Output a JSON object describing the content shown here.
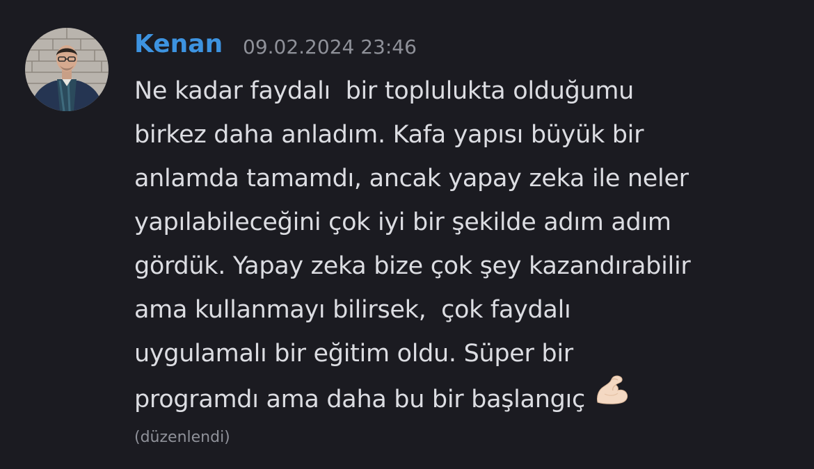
{
  "message": {
    "author": "Kenan",
    "timestamp": "09.02.2024 23:46",
    "lines": [
      "Ne kadar faydalı  bir toplulukta olduğumu",
      "birkez daha anladım. Kafa yapısı büyük bir",
      "anlamda tamamdı, ancak yapay zeka ile neler",
      "yapılabileceğini çok iyi bir şekilde adım adım",
      "gördük. Yapay zeka bize çok şey kazandırabilir",
      "ama kullanmayı bilirsek,  çok faydalı",
      "uygulamalı bir eğitim oldu. Süper bir",
      "programdı ama daha bu bir başlangıç"
    ],
    "emoji": "flexed-biceps-emoji",
    "edited_label": "(düzenlendi)"
  },
  "colors": {
    "background": "#1b1b21",
    "author": "#3d93e0",
    "text": "#dcdde2",
    "muted": "#8f9199"
  }
}
